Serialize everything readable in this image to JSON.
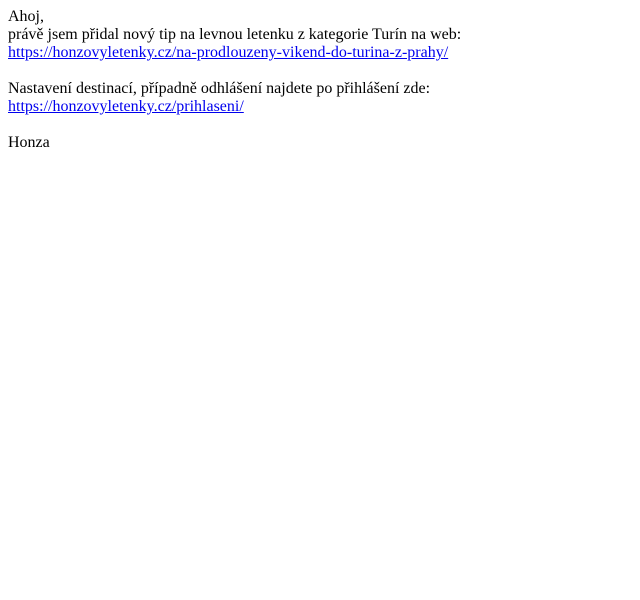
{
  "message": {
    "greeting": "Ahoj,",
    "intro_line": "právě jsem přidal nový tip na levnou letenku z kategorie Turín na web:",
    "tip_link": "https://honzovyletenky.cz/na-prodlouzeny-vikend-do-turina-z-prahy/",
    "settings_line": "Nastavení destinací, případně odhlášení najdete po přihlášení zde:",
    "login_link": "https://honzovyletenky.cz/prihlaseni/",
    "signature": "Honza"
  },
  "colors": {
    "text": "#000000",
    "link": "#0000ee",
    "background": "#ffffff"
  }
}
